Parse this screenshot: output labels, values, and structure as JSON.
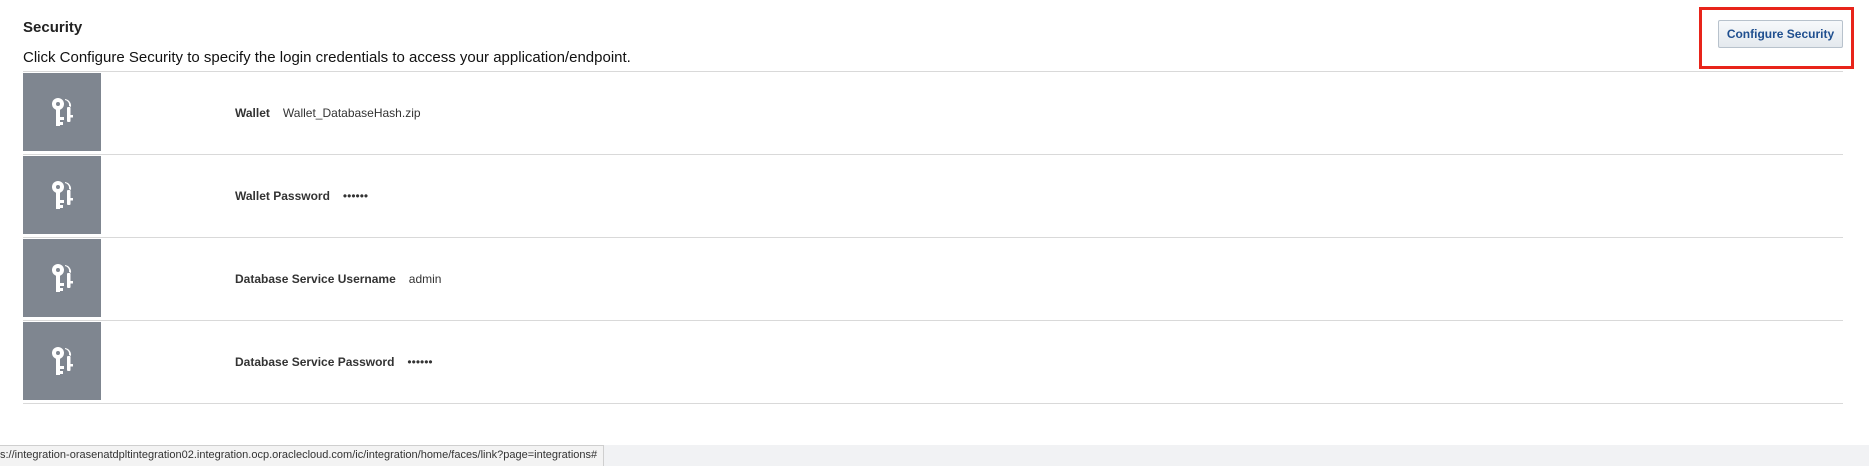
{
  "security": {
    "title": "Security",
    "description": "Click Configure Security to specify the login credentials to access your application/endpoint.",
    "configure_button_label": "Configure Security",
    "fields": [
      {
        "icon": "keys-icon",
        "label": "Wallet",
        "value": "Wallet_DatabaseHash.zip"
      },
      {
        "icon": "keys-icon",
        "label": "Wallet Password",
        "value": "••••••"
      },
      {
        "icon": "keys-icon",
        "label": "Database Service Username",
        "value": "admin"
      },
      {
        "icon": "keys-icon",
        "label": "Database Service Password",
        "value": "••••••"
      }
    ]
  },
  "status_bar": {
    "url": "s://integration-orasenatdpltintegration02.integration.ocp.oraclecloud.com/ic/integration/home/faces/link?page=integrations#"
  },
  "colors": {
    "highlight": "#e8241a",
    "tile": "#7f8690",
    "button_text": "#1f4f8f"
  }
}
